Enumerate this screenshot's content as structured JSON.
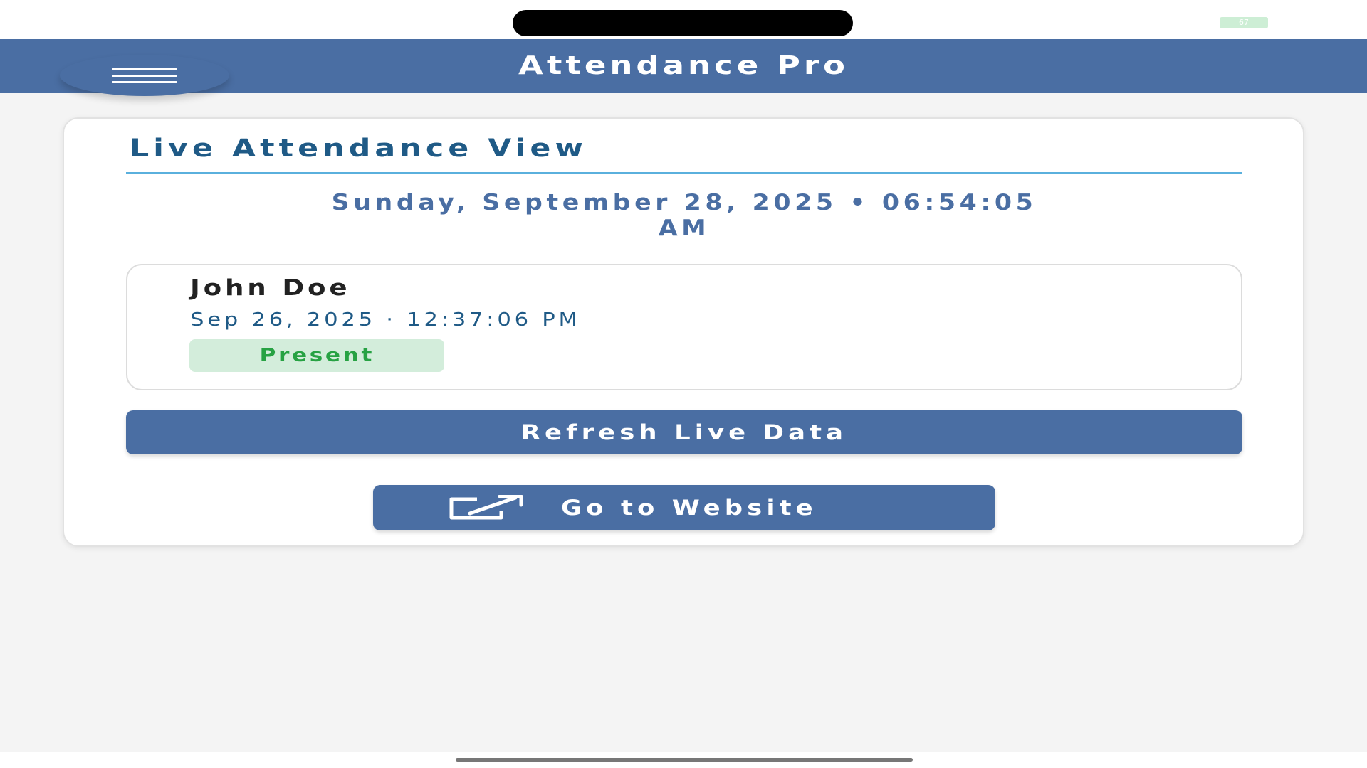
{
  "status_bar": {
    "battery_label": "67"
  },
  "header": {
    "title": "Attendance Pro",
    "menu_icon": "hamburger-menu-icon"
  },
  "card": {
    "title": "Live Attendance View",
    "datetime_line1": "Sunday, September 28, 2025 • 06:54:05",
    "datetime_line2": "AM",
    "record": {
      "name": "John Doe",
      "timestamp": "Sep 26, 2025 · 12:37:06 PM",
      "status": "Present"
    },
    "refresh_label": "Refresh Live Data",
    "website_label": "Go to Website",
    "website_icon": "external-link-icon"
  },
  "colors": {
    "primary": "#4a6ea3",
    "title_blue": "#1f5a86",
    "rule": "#5ab0dd",
    "present_bg": "#d3eddb",
    "present_text": "#27a243"
  }
}
